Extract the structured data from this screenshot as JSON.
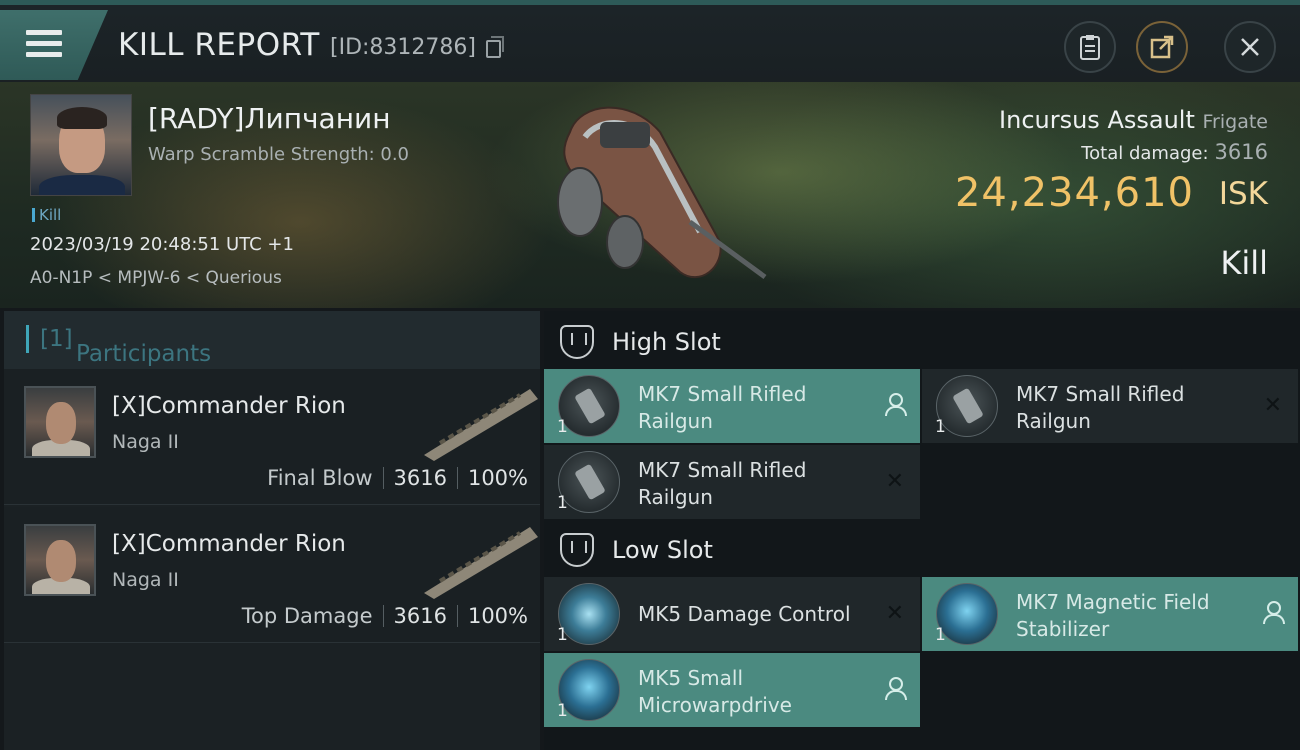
{
  "header": {
    "title": "KILL REPORT",
    "report_id": "[ID:8312786]",
    "icons": [
      "menu-icon",
      "copy-icon",
      "clipboard-icon",
      "share-icon",
      "close-icon"
    ]
  },
  "victim": {
    "name": "[RADY]Липчанин",
    "warp_scramble": "Warp Scramble Strength: 0.0",
    "tag": "Kill",
    "datetime": "2023/03/19 20:48:51 UTC +1",
    "location": "A0-N1P < MPJW-6 < Querious",
    "ship_name": "Incursus Assault",
    "ship_class": "Frigate",
    "total_damage_label": "Total damage:",
    "total_damage": "3616",
    "isk_value": "24,234,610",
    "isk_label": "ISK",
    "result": "Kill"
  },
  "participants": {
    "header": "Participants",
    "count": "[1]",
    "list": [
      {
        "name": "[X]Commander Rion",
        "ship": "Naga II",
        "label": "Final Blow",
        "damage": "3616",
        "percent": "100%"
      },
      {
        "name": "[X]Commander Rion",
        "ship": "Naga II",
        "label": "Top Damage",
        "damage": "3616",
        "percent": "100%"
      }
    ]
  },
  "fitting": {
    "high_slot": {
      "title": "High Slot",
      "items": [
        {
          "name": "MK7 Small Rifled Railgun",
          "qty": "1",
          "status": "person"
        },
        {
          "name": "MK7 Small Rifled Railgun",
          "qty": "1",
          "status": "destroyed"
        },
        {
          "name": "MK7 Small Rifled Railgun",
          "qty": "1",
          "status": "destroyed"
        }
      ]
    },
    "low_slot": {
      "title": "Low Slot",
      "items": [
        {
          "name": "MK5 Damage Control",
          "qty": "1",
          "status": "destroyed"
        },
        {
          "name": "MK7 Magnetic Field Stabilizer",
          "qty": "1",
          "status": "person"
        },
        {
          "name": "MK5 Small Microwarpdrive",
          "qty": "1",
          "status": "person"
        }
      ]
    },
    "status_marks": {
      "destroyed": "✕"
    }
  },
  "colors": {
    "accent": "#4b8a80",
    "isk": "#f0c267",
    "header_teal": "#3f6f6b"
  }
}
